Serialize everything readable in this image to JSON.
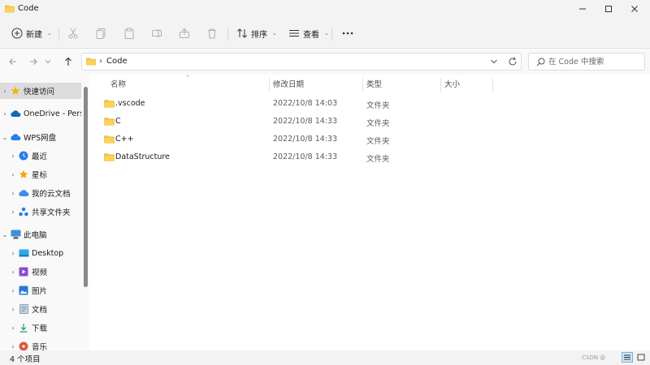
{
  "window": {
    "title": "Code"
  },
  "toolbar": {
    "new_label": "新建",
    "sort_label": "排序",
    "view_label": "查看"
  },
  "address": {
    "crumbs": [
      "Code"
    ],
    "search_placeholder": "在 Code 中搜索"
  },
  "sidebar": {
    "items": [
      {
        "label": "快速访问",
        "icon": "star-icon",
        "level": 0,
        "selected": true
      },
      {
        "label": "OneDrive - Pers",
        "icon": "cloud-icon",
        "level": 0
      },
      {
        "label": "WPS网盘",
        "icon": "wps-cloud-icon",
        "level": 0,
        "expanded": true
      },
      {
        "label": "最近",
        "icon": "clock-icon",
        "level": 1
      },
      {
        "label": "星标",
        "icon": "star-icon",
        "level": 1
      },
      {
        "label": "我的云文档",
        "icon": "cloud-icon",
        "level": 1
      },
      {
        "label": "共享文件夹",
        "icon": "share-icon",
        "level": 1
      },
      {
        "label": "此电脑",
        "icon": "computer-icon",
        "level": 0,
        "expanded": true
      },
      {
        "label": "Desktop",
        "icon": "desktop-icon",
        "level": 1
      },
      {
        "label": "视频",
        "icon": "video-icon",
        "level": 1
      },
      {
        "label": "图片",
        "icon": "picture-icon",
        "level": 1
      },
      {
        "label": "文档",
        "icon": "document-icon",
        "level": 1
      },
      {
        "label": "下载",
        "icon": "download-icon",
        "level": 1
      },
      {
        "label": "音乐",
        "icon": "music-icon",
        "level": 1
      }
    ]
  },
  "columns": {
    "name": "名称",
    "modified": "修改日期",
    "type": "类型",
    "size": "大小"
  },
  "files": [
    {
      "name": ".vscode",
      "modified": "2022/10/8 14:03",
      "type": "文件夹",
      "size": ""
    },
    {
      "name": "C",
      "modified": "2022/10/8 14:33",
      "type": "文件夹",
      "size": ""
    },
    {
      "name": "C++",
      "modified": "2022/10/8 14:33",
      "type": "文件夹",
      "size": ""
    },
    {
      "name": "DataStructure",
      "modified": "2022/10/8 14:33",
      "type": "文件夹",
      "size": ""
    }
  ],
  "status": {
    "item_count": "4 个项目",
    "watermark": "CSDN @"
  },
  "colors": {
    "folder": "#f4c542",
    "accent": "#0067c0",
    "selected": "#dcdcdc"
  }
}
